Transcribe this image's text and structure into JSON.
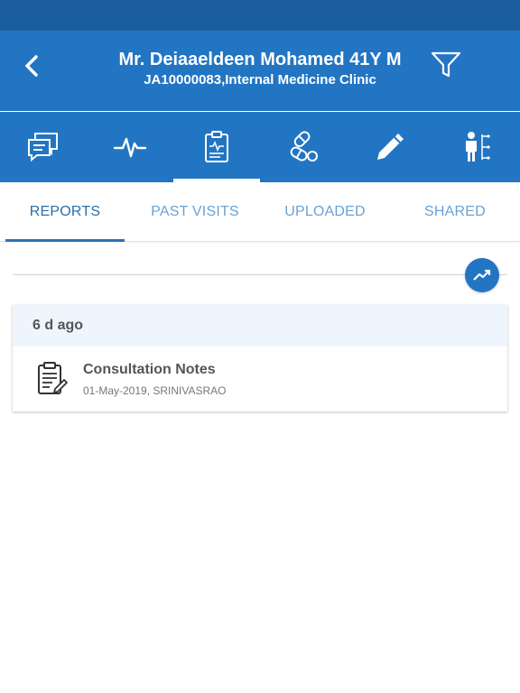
{
  "header": {
    "patient_title": "Mr. Deiaaeldeen Mohamed 41Y M",
    "patient_subtitle": "JA10000083,Internal Medicine Clinic"
  },
  "icon_bar": {
    "items": [
      {
        "icon": "chat-icon"
      },
      {
        "icon": "vitals-icon"
      },
      {
        "icon": "clipboard-icon",
        "active": true
      },
      {
        "icon": "pills-icon"
      },
      {
        "icon": "pen-icon"
      },
      {
        "icon": "patient-tree-icon"
      }
    ]
  },
  "tabs": [
    {
      "label": "REPORTS",
      "active": true
    },
    {
      "label": "PAST VISITS"
    },
    {
      "label": "UPLOADED"
    },
    {
      "label": "SHARED"
    }
  ],
  "report_group": {
    "time_ago": "6 d ago",
    "items": [
      {
        "title": "Consultation Notes",
        "subtitle": "01-May-2019, SRINIVASRAO",
        "icon": "clipboard-pen-icon"
      }
    ]
  },
  "colors": {
    "primary": "#2275c3",
    "status_bar": "#1b5e9e",
    "tab_active": "#2a6fa8",
    "tab_inactive": "#6aa2d2",
    "card_header_bg": "#eef5fc"
  }
}
